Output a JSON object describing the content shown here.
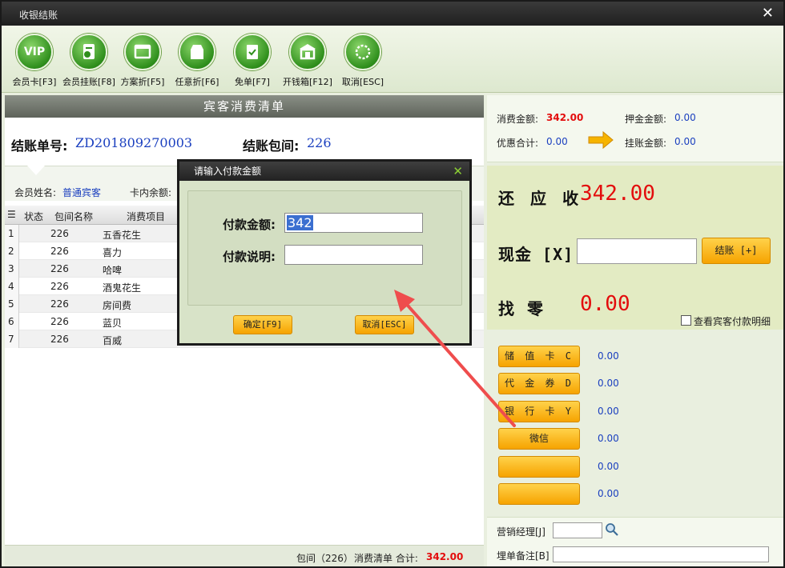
{
  "window": {
    "title": "收银结账",
    "close": "✕"
  },
  "toolbar": [
    {
      "label": "会员卡[F3]",
      "glyph": "VIP",
      "icon": "vip-card-icon"
    },
    {
      "label": "会员挂账[F8]",
      "glyph": "",
      "icon": "member-credit-icon"
    },
    {
      "label": "方案折[F5]",
      "glyph": "",
      "icon": "plan-discount-icon"
    },
    {
      "label": "任意折[F6]",
      "glyph": "",
      "icon": "custom-discount-icon"
    },
    {
      "label": "免单[F7]",
      "glyph": "",
      "icon": "free-order-icon"
    },
    {
      "label": "开钱箱[F12]",
      "glyph": "",
      "icon": "cash-drawer-icon"
    },
    {
      "label": "取消[ESC]",
      "glyph": "",
      "icon": "cancel-icon"
    }
  ],
  "list": {
    "title": "宾客消费清单",
    "bill_no_label": "结账单号:",
    "bill_no": "ZD201809270003",
    "room_label": "结账包间:",
    "room": "226",
    "member_name_label": "会员姓名:",
    "member_name": "普通宾客",
    "card_balance_label": "卡内余额:",
    "columns": [
      "状态",
      "包间名称",
      "消费项目"
    ],
    "rows": [
      {
        "idx": "1",
        "room": "226",
        "item": "五香花生"
      },
      {
        "idx": "2",
        "room": "226",
        "item": "喜力"
      },
      {
        "idx": "3",
        "room": "226",
        "item": "哈啤"
      },
      {
        "idx": "4",
        "room": "226",
        "item": "酒鬼花生"
      },
      {
        "idx": "5",
        "room": "226",
        "item": "房间费"
      },
      {
        "idx": "6",
        "room": "226",
        "item": "蓝贝"
      },
      {
        "idx": "7",
        "room": "226",
        "item": "百威"
      }
    ],
    "footer_room": "包间（226）",
    "footer_list": "消费清单 合计:",
    "footer_total": "342.00"
  },
  "summary": {
    "consume_label": "消费金额:",
    "consume": "342.00",
    "deposit_label": "押金金额:",
    "deposit": "0.00",
    "discount_label": "优惠合计:",
    "discount": "0.00",
    "credit_label": "挂账金额:",
    "credit": "0.00"
  },
  "due": {
    "receivable_label": "还 应 收",
    "receivable": "342.00",
    "cash_label": "现金 [X]",
    "checkout_button": "结账 [+]",
    "change_label": "找  零",
    "change": "0.00",
    "show_detail_label": "查看宾客付款明细"
  },
  "payments": [
    {
      "label": "储 值 卡 C",
      "value": "0.00"
    },
    {
      "label": "代 金 券 D",
      "value": "0.00"
    },
    {
      "label": "银 行 卡 Y",
      "value": "0.00"
    },
    {
      "label": "微信",
      "value": "0.00"
    },
    {
      "label": "",
      "value": "0.00"
    },
    {
      "label": "",
      "value": "0.00"
    }
  ],
  "bottom": {
    "manager_label": "营销经理[J]",
    "remark_label": "埋单备注[B]"
  },
  "dialog": {
    "title": "请输入付款金额",
    "close": "✕",
    "amount_label": "付款金额:",
    "amount_value": "342",
    "note_label": "付款说明:",
    "note_value": "",
    "ok_button": "确定[F9]",
    "cancel_button": "取消[ESC]"
  },
  "colors": {
    "accent_red": "#e30d0d",
    "value_blue": "#1a3fbf",
    "button_orange": "#f6a300",
    "arrow": "#ef4d4d"
  }
}
